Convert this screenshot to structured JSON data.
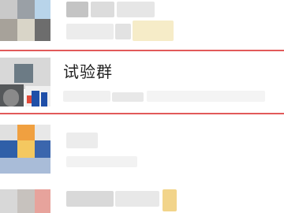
{
  "chat_list": {
    "items": [
      {
        "name": "",
        "preview": "",
        "obscured": true
      },
      {
        "name": "试验群",
        "preview": "",
        "obscured": false,
        "highlighted": true
      },
      {
        "name": "",
        "preview": "",
        "obscured": true
      },
      {
        "name": "",
        "preview": "",
        "obscured": true
      }
    ]
  },
  "colors": {
    "highlight_border": "#e25a5a",
    "text": "#222222",
    "background": "#ffffff",
    "accent_blue": "#2f5fa8",
    "accent_orange": "#f0a040"
  },
  "icons": {
    "group_avatar": "group-avatar-icon"
  }
}
